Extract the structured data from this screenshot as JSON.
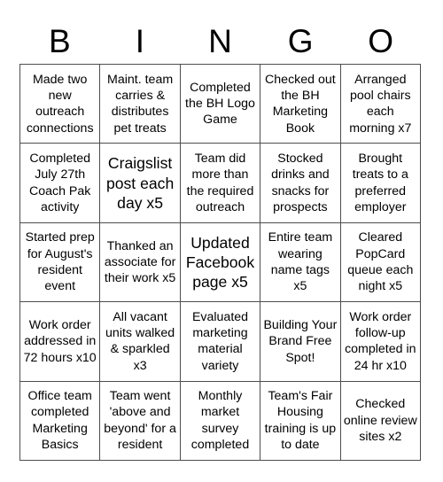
{
  "card": {
    "header_letters": [
      "B",
      "I",
      "N",
      "G",
      "O"
    ],
    "columns": 5,
    "rows": 5,
    "cells": [
      {
        "text": "Made two new outreach connections",
        "emphasis": "normal"
      },
      {
        "text": "Maint. team carries & distributes pet treats",
        "emphasis": "normal"
      },
      {
        "text": "Completed the BH Logo Game",
        "emphasis": "normal"
      },
      {
        "text": "Checked out the BH Marketing Book",
        "emphasis": "normal"
      },
      {
        "text": "Arranged pool chairs each morning x7",
        "emphasis": "normal"
      },
      {
        "text": "Completed July 27th Coach Pak activity",
        "emphasis": "normal"
      },
      {
        "text": "Craigslist post each day x5",
        "emphasis": "large"
      },
      {
        "text": "Team did more than the required outreach",
        "emphasis": "normal"
      },
      {
        "text": "Stocked drinks and snacks for prospects",
        "emphasis": "normal"
      },
      {
        "text": "Brought treats to a preferred employer",
        "emphasis": "normal"
      },
      {
        "text": "Started prep for August's resident event",
        "emphasis": "normal"
      },
      {
        "text": "Thanked an associate for their work x5",
        "emphasis": "normal"
      },
      {
        "text": "Updated Facebook page x5",
        "emphasis": "large"
      },
      {
        "text": "Entire team wearing name tags x5",
        "emphasis": "normal"
      },
      {
        "text": "Cleared PopCard queue each night x5",
        "emphasis": "normal"
      },
      {
        "text": "Work order addressed in 72 hours x10",
        "emphasis": "normal"
      },
      {
        "text": "All vacant units walked & sparkled x3",
        "emphasis": "normal"
      },
      {
        "text": "Evaluated marketing material variety",
        "emphasis": "normal"
      },
      {
        "text": "Building Your Brand Free Spot!",
        "emphasis": "normal"
      },
      {
        "text": "Work order follow-up completed in 24 hr x10",
        "emphasis": "normal"
      },
      {
        "text": "Office team completed Marketing Basics",
        "emphasis": "normal"
      },
      {
        "text": "Team went 'above and beyond' for a resident",
        "emphasis": "normal"
      },
      {
        "text": "Monthly market survey completed",
        "emphasis": "normal"
      },
      {
        "text": "Team's Fair Housing training is up to date",
        "emphasis": "normal"
      },
      {
        "text": "Checked online review sites x2",
        "emphasis": "normal"
      }
    ]
  },
  "colors": {
    "background": "#ffffff",
    "text": "#000000",
    "border": "#4d4d4d"
  }
}
